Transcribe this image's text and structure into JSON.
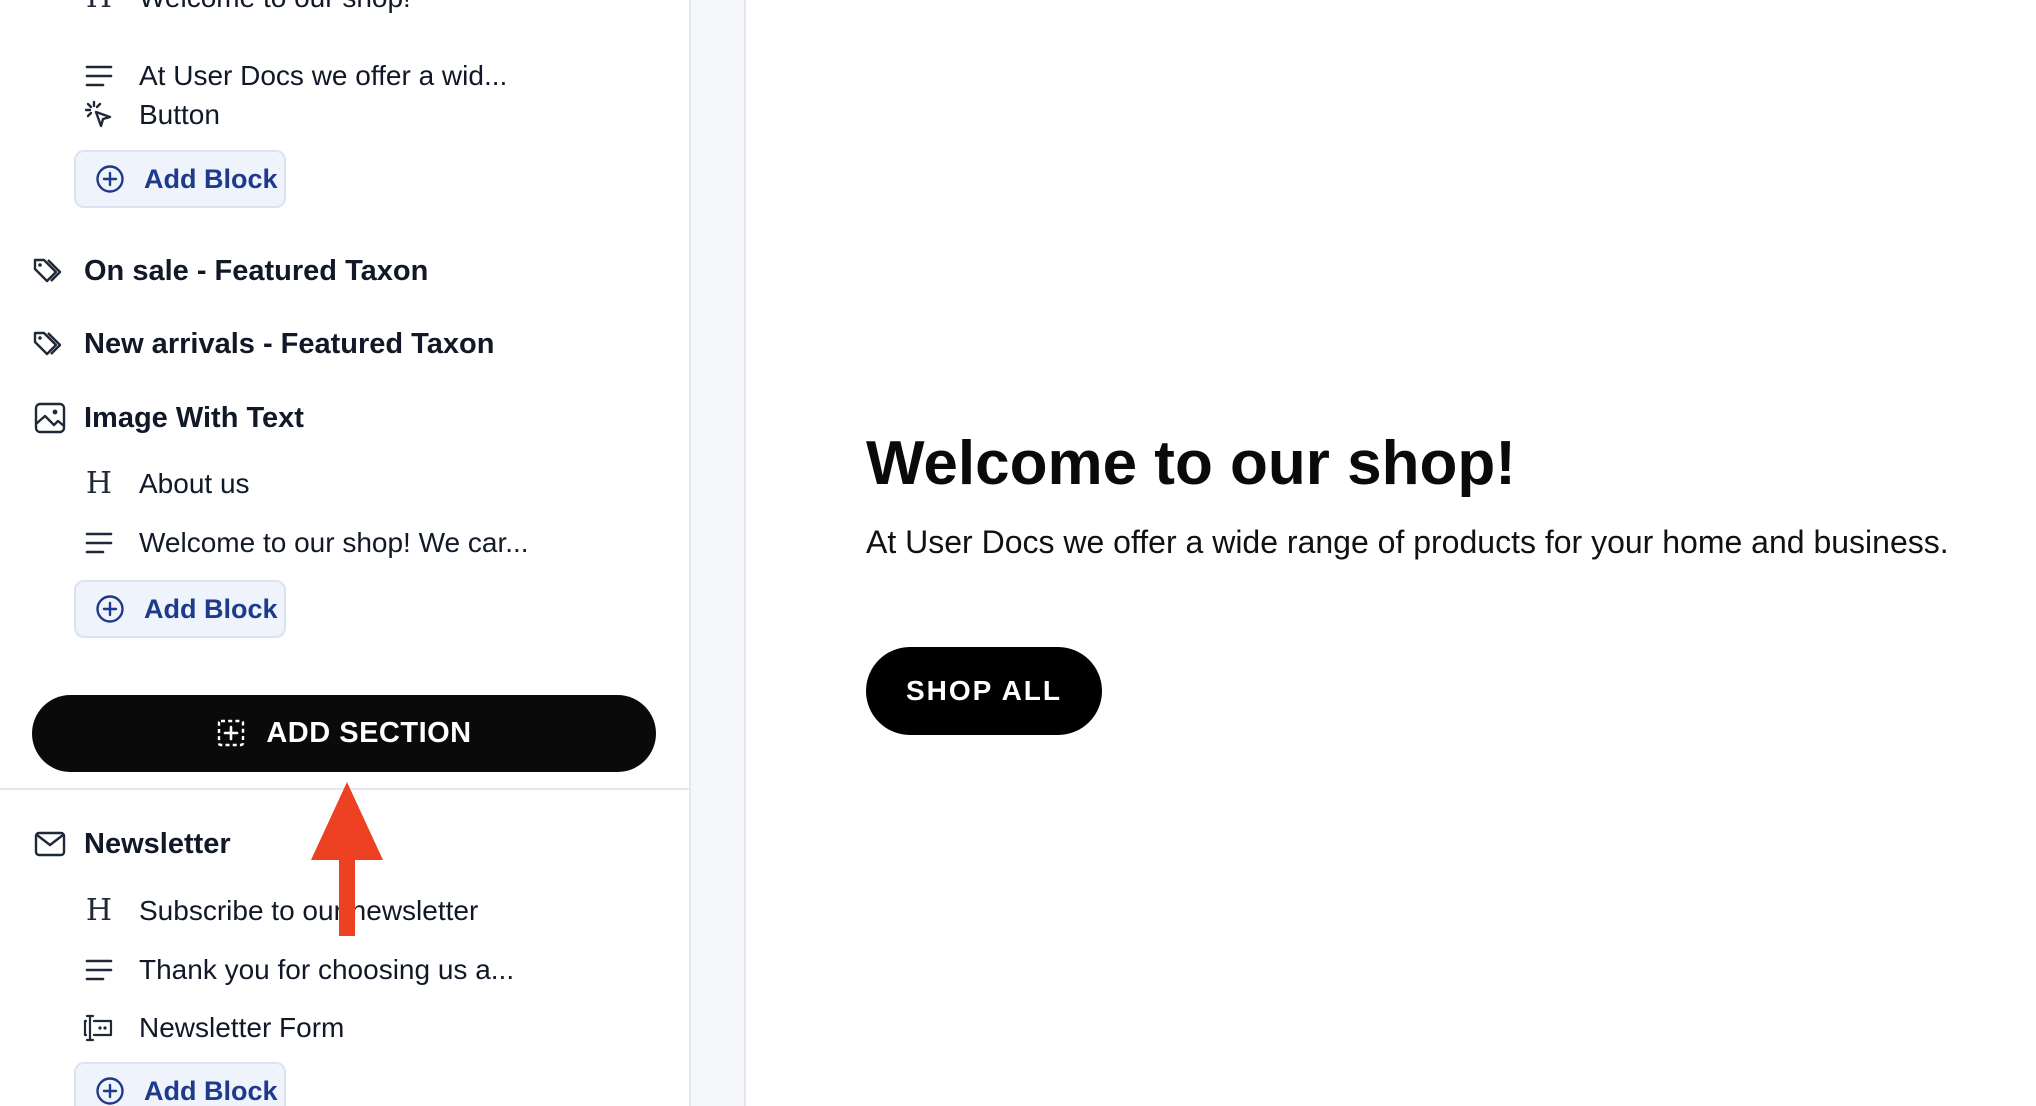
{
  "sidebar": {
    "top_partial_heading": "Welcome to our shop!",
    "hero_blocks": [
      {
        "type": "text",
        "icon": "paragraph-icon",
        "label": "At User Docs we offer a wid..."
      },
      {
        "type": "button",
        "icon": "click-icon",
        "label": "Button"
      }
    ],
    "add_block_label": "Add Block",
    "sections": [
      {
        "icon": "tag-icon",
        "label": "On sale - Featured Taxon"
      },
      {
        "icon": "tag-icon",
        "label": "New arrivals - Featured Taxon"
      },
      {
        "icon": "image-icon",
        "label": "Image With Text"
      }
    ],
    "image_with_text_blocks": [
      {
        "type": "heading",
        "icon": "heading-icon",
        "label": "About us"
      },
      {
        "type": "text",
        "icon": "paragraph-icon",
        "label": "Welcome to our shop! We car..."
      }
    ],
    "add_section_label": "ADD SECTION",
    "newsletter": {
      "icon": "mail-icon",
      "label": "Newsletter",
      "blocks": [
        {
          "type": "heading",
          "icon": "heading-icon",
          "label": "Subscribe to our newsletter"
        },
        {
          "type": "text",
          "icon": "paragraph-icon",
          "label": "Thank you for choosing us a..."
        },
        {
          "type": "form",
          "icon": "form-input-icon",
          "label": "Newsletter Form"
        }
      ]
    },
    "heading_glyph": "H"
  },
  "preview": {
    "title": "Welcome to our shop!",
    "text": "At User Docs we offer a wide range of products for your home and business.",
    "button": "SHOP ALL"
  },
  "annotation": {
    "type": "arrow",
    "color": "#ee4123",
    "points_to": "add-section-button"
  },
  "colors": {
    "add_block_bg": "#eff3fb",
    "add_block_text": "#1e3a8a",
    "add_section_bg": "#0a0a0a",
    "gutter_bg": "#f4f6f9"
  }
}
